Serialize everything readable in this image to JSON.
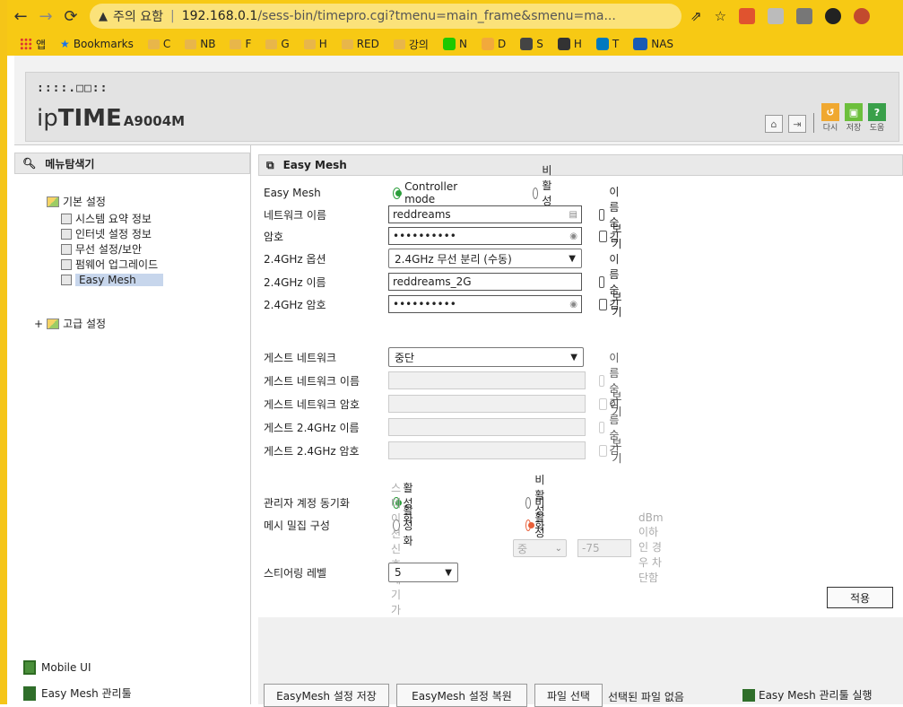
{
  "browser": {
    "warning": "주의 요함",
    "url_host": "192.168.0.1",
    "url_path": "/sess-bin/timepro.cgi?tmenu=main_frame&smenu=ma...",
    "bookmarks": [
      "앱",
      "Bookmarks",
      "C",
      "NB",
      "F",
      "G",
      "H",
      "RED",
      "강의",
      "N",
      "D",
      "S",
      "H",
      "T",
      "NAS"
    ]
  },
  "header": {
    "logo_dots": "::::.□□::",
    "logo_ip": "ip",
    "logo_time": "TIME",
    "model": "A9004M",
    "btn_redo": "다시",
    "btn_save": "저장",
    "btn_help": "도움"
  },
  "left": {
    "title": "메뉴탐색기",
    "basic_label": "기본 설정",
    "items": [
      "시스템 요약 정보",
      "인터넷 설정 정보",
      "무선 설정/보안",
      "펌웨어 업그레이드",
      "Easy Mesh"
    ],
    "advanced_label": "고급 설정",
    "mobile_ui": "Mobile UI",
    "easymesh_tool": "Easy Mesh 관리툴"
  },
  "main": {
    "title": "Easy Mesh",
    "easymesh_label": "Easy Mesh",
    "mode_controller": "Controller mode",
    "mode_disabled": "비활성화",
    "network_name_label": "네트워크 이름",
    "network_name_value": "reddreams",
    "hide_name": "이름숨김",
    "password_label": "암호",
    "password_value": "••••••••••",
    "show": "보기",
    "band_option_label": "2.4GHz 옵션",
    "band_option_value": "2.4GHz 무선 분리 (수동)",
    "band_name_label": "2.4GHz 이름",
    "band_name_value": "reddreams_2G",
    "band_pw_label": "2.4GHz 암호",
    "band_pw_value": "••••••••••",
    "guest_net_label": "게스트 네트워크",
    "guest_net_value": "중단",
    "guest_name_label": "게스트 네트워크 이름",
    "guest_pw_label": "게스트 네트워크 암호",
    "guest_24_name_label": "게스트 2.4GHz 이름",
    "guest_24_pw_label": "게스트 2.4GHz 암호",
    "admin_sync_label": "관리자 계정 동기화",
    "enable": "활성화",
    "disable": "비활성화",
    "mesh_dense_label": "메시 밀집 구성",
    "rssi_hint_pre": "스테이션 신호세기가",
    "rssi_level": "중",
    "rssi_value": "-75",
    "rssi_hint_post": "dBm 이하인 경우 차단함",
    "steering_label": "스티어링 레벨",
    "steering_value": "5",
    "apply": "적용",
    "save_settings": "EasyMesh 설정 저장",
    "restore_settings": "EasyMesh 설정 복원",
    "choose_file": "파일 선택",
    "no_file": "선택된 파일 없음",
    "run_tool": "Easy Mesh 관리툴 실행"
  }
}
